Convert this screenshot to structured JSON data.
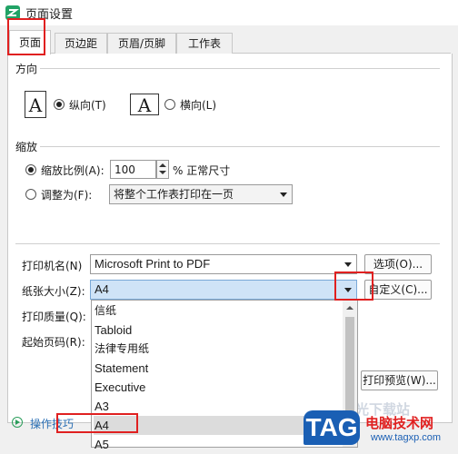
{
  "window": {
    "title": "页面设置"
  },
  "tabs": [
    {
      "label": "页面"
    },
    {
      "label": "页边距"
    },
    {
      "label": "页眉/页脚"
    },
    {
      "label": "工作表"
    }
  ],
  "orientation": {
    "section_label": "方向",
    "portrait_label": "纵向(T)",
    "landscape_label": "横向(L)",
    "icon_glyph": "A",
    "selected": "portrait"
  },
  "scaling": {
    "section_label": "缩放",
    "scale_label": "缩放比例(A):",
    "scale_value": "100",
    "scale_suffix": "% 正常尺寸",
    "fit_label": "调整为(F):",
    "fit_value": "将整个工作表打印在一页",
    "selected": "scale"
  },
  "printer": {
    "label": "打印机名(N)",
    "value": "Microsoft Print to PDF",
    "options_button": "选项(O)..."
  },
  "paper": {
    "label": "纸张大小(Z):",
    "value": "A4",
    "custom_button": "自定义(C)...",
    "options": [
      "信纸",
      "Tabloid",
      "法律专用纸",
      "Statement",
      "Executive",
      "A3",
      "A4",
      "A5"
    ],
    "selected_index": 6
  },
  "quality": {
    "label": "打印质量(Q):"
  },
  "first_page": {
    "label": "起始页码(R):"
  },
  "preview_button": "打印预览(W)...",
  "tips_link": "操作技巧",
  "watermark": {
    "tag": "TAG",
    "site_name": "电脑技术网",
    "site_url": "www.tagxp.com",
    "faint_text": "极光下载站"
  },
  "colors": {
    "accent_red": "#e02020",
    "selection_blue": "#cfe3f7",
    "tag_blue": "#1a5fb4",
    "wps_green": "#21a366"
  }
}
